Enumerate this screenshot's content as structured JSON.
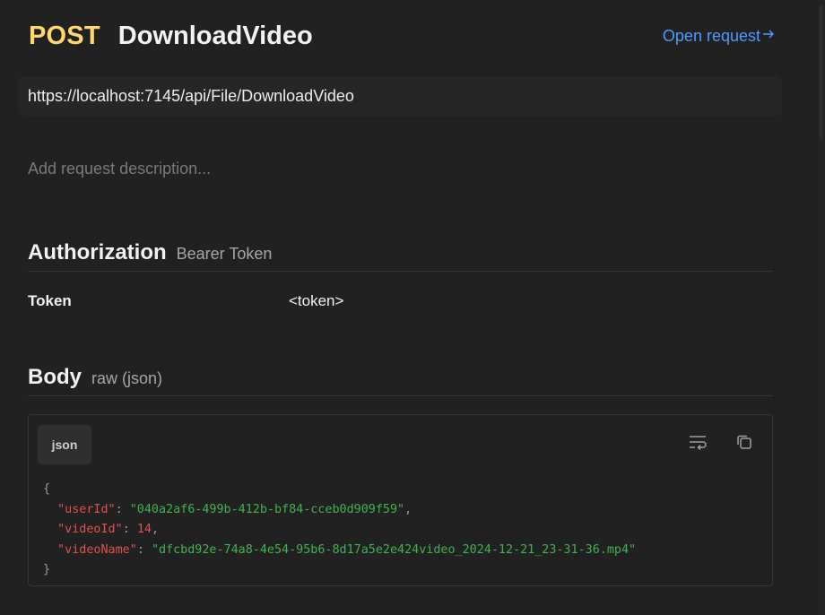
{
  "request": {
    "method": "POST",
    "name": "DownloadVideo",
    "open_link": "Open request",
    "url": "https://localhost:7145/api/File/DownloadVideo",
    "description_placeholder": "Add request description..."
  },
  "authorization": {
    "title": "Authorization",
    "type": "Bearer Token",
    "key": "Token",
    "value": "<token>"
  },
  "body": {
    "title": "Body",
    "mode": "raw (json)",
    "language": "json",
    "json": {
      "open_brace": "{",
      "close_brace": "}",
      "fields": [
        {
          "key": "\"userId\"",
          "value": "\"040a2af6-499b-412b-bf84-cceb0d909f59\"",
          "trail": ","
        },
        {
          "key": "\"videoId\"",
          "value": "14",
          "trail": ","
        },
        {
          "key": "\"videoName\"",
          "value": "\"dfcbd92e-74a8-4e54-95b6-8d17a5e2e424video_2024-12-21_23-31-36.mp4\"",
          "trail": ""
        }
      ]
    }
  },
  "icons": {
    "open_link": "arrow-right-icon",
    "wrap": "wrap-text-icon",
    "copy": "copy-icon"
  },
  "colors": {
    "method": "#ffd76e",
    "link": "#4d9bff",
    "json_key": "#e05050",
    "json_string": "#3fb34f",
    "json_number": "#e05050"
  }
}
